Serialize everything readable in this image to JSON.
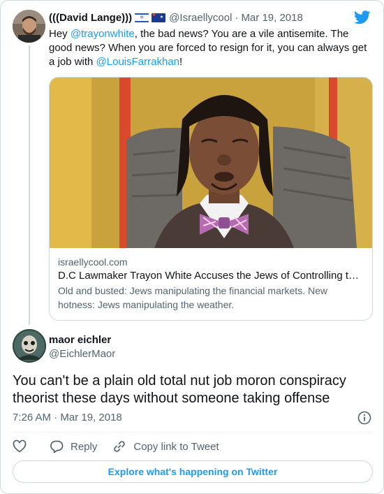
{
  "parent_tweet": {
    "display_name": "(((David Lange)))",
    "flags": [
      "israel-flag",
      "australia-flag"
    ],
    "handle": "@Israellycool",
    "separator": "·",
    "date": "Mar 19, 2018",
    "text_parts": [
      {
        "text": "Hey ",
        "link": false
      },
      {
        "text": "@trayonwhite",
        "link": true
      },
      {
        "text": ", the bad news? You are a vile antisemite. The good news? When you are forced to resign for it, you can always get a job with ",
        "link": false
      },
      {
        "text": "@LouisFarrakhan",
        "link": true
      },
      {
        "text": "!",
        "link": false
      }
    ],
    "link_card": {
      "domain": "israellycool.com",
      "title": "D.C Lawmaker Trayon White Accuses the Jews of Controlling t…",
      "description": "Old and busted: Jews manipulating the financial markets. New hotness: Jews manipulating the weather."
    }
  },
  "main_tweet": {
    "display_name": "maor eichler",
    "handle": "@EichlerMaor",
    "text": "You can't be a plain old total nut job moron conspiracy theorist these days without someone taking offense",
    "timestamp": "7:26 AM · Mar 19, 2018"
  },
  "actions": {
    "reply_label": "Reply",
    "copy_label": "Copy link to Tweet"
  },
  "explore_label": "Explore what's happening on Twitter",
  "colors": {
    "link": "#1d9bf0",
    "text": "#0f1419",
    "secondary": "#536471",
    "border": "#cfd9de"
  }
}
